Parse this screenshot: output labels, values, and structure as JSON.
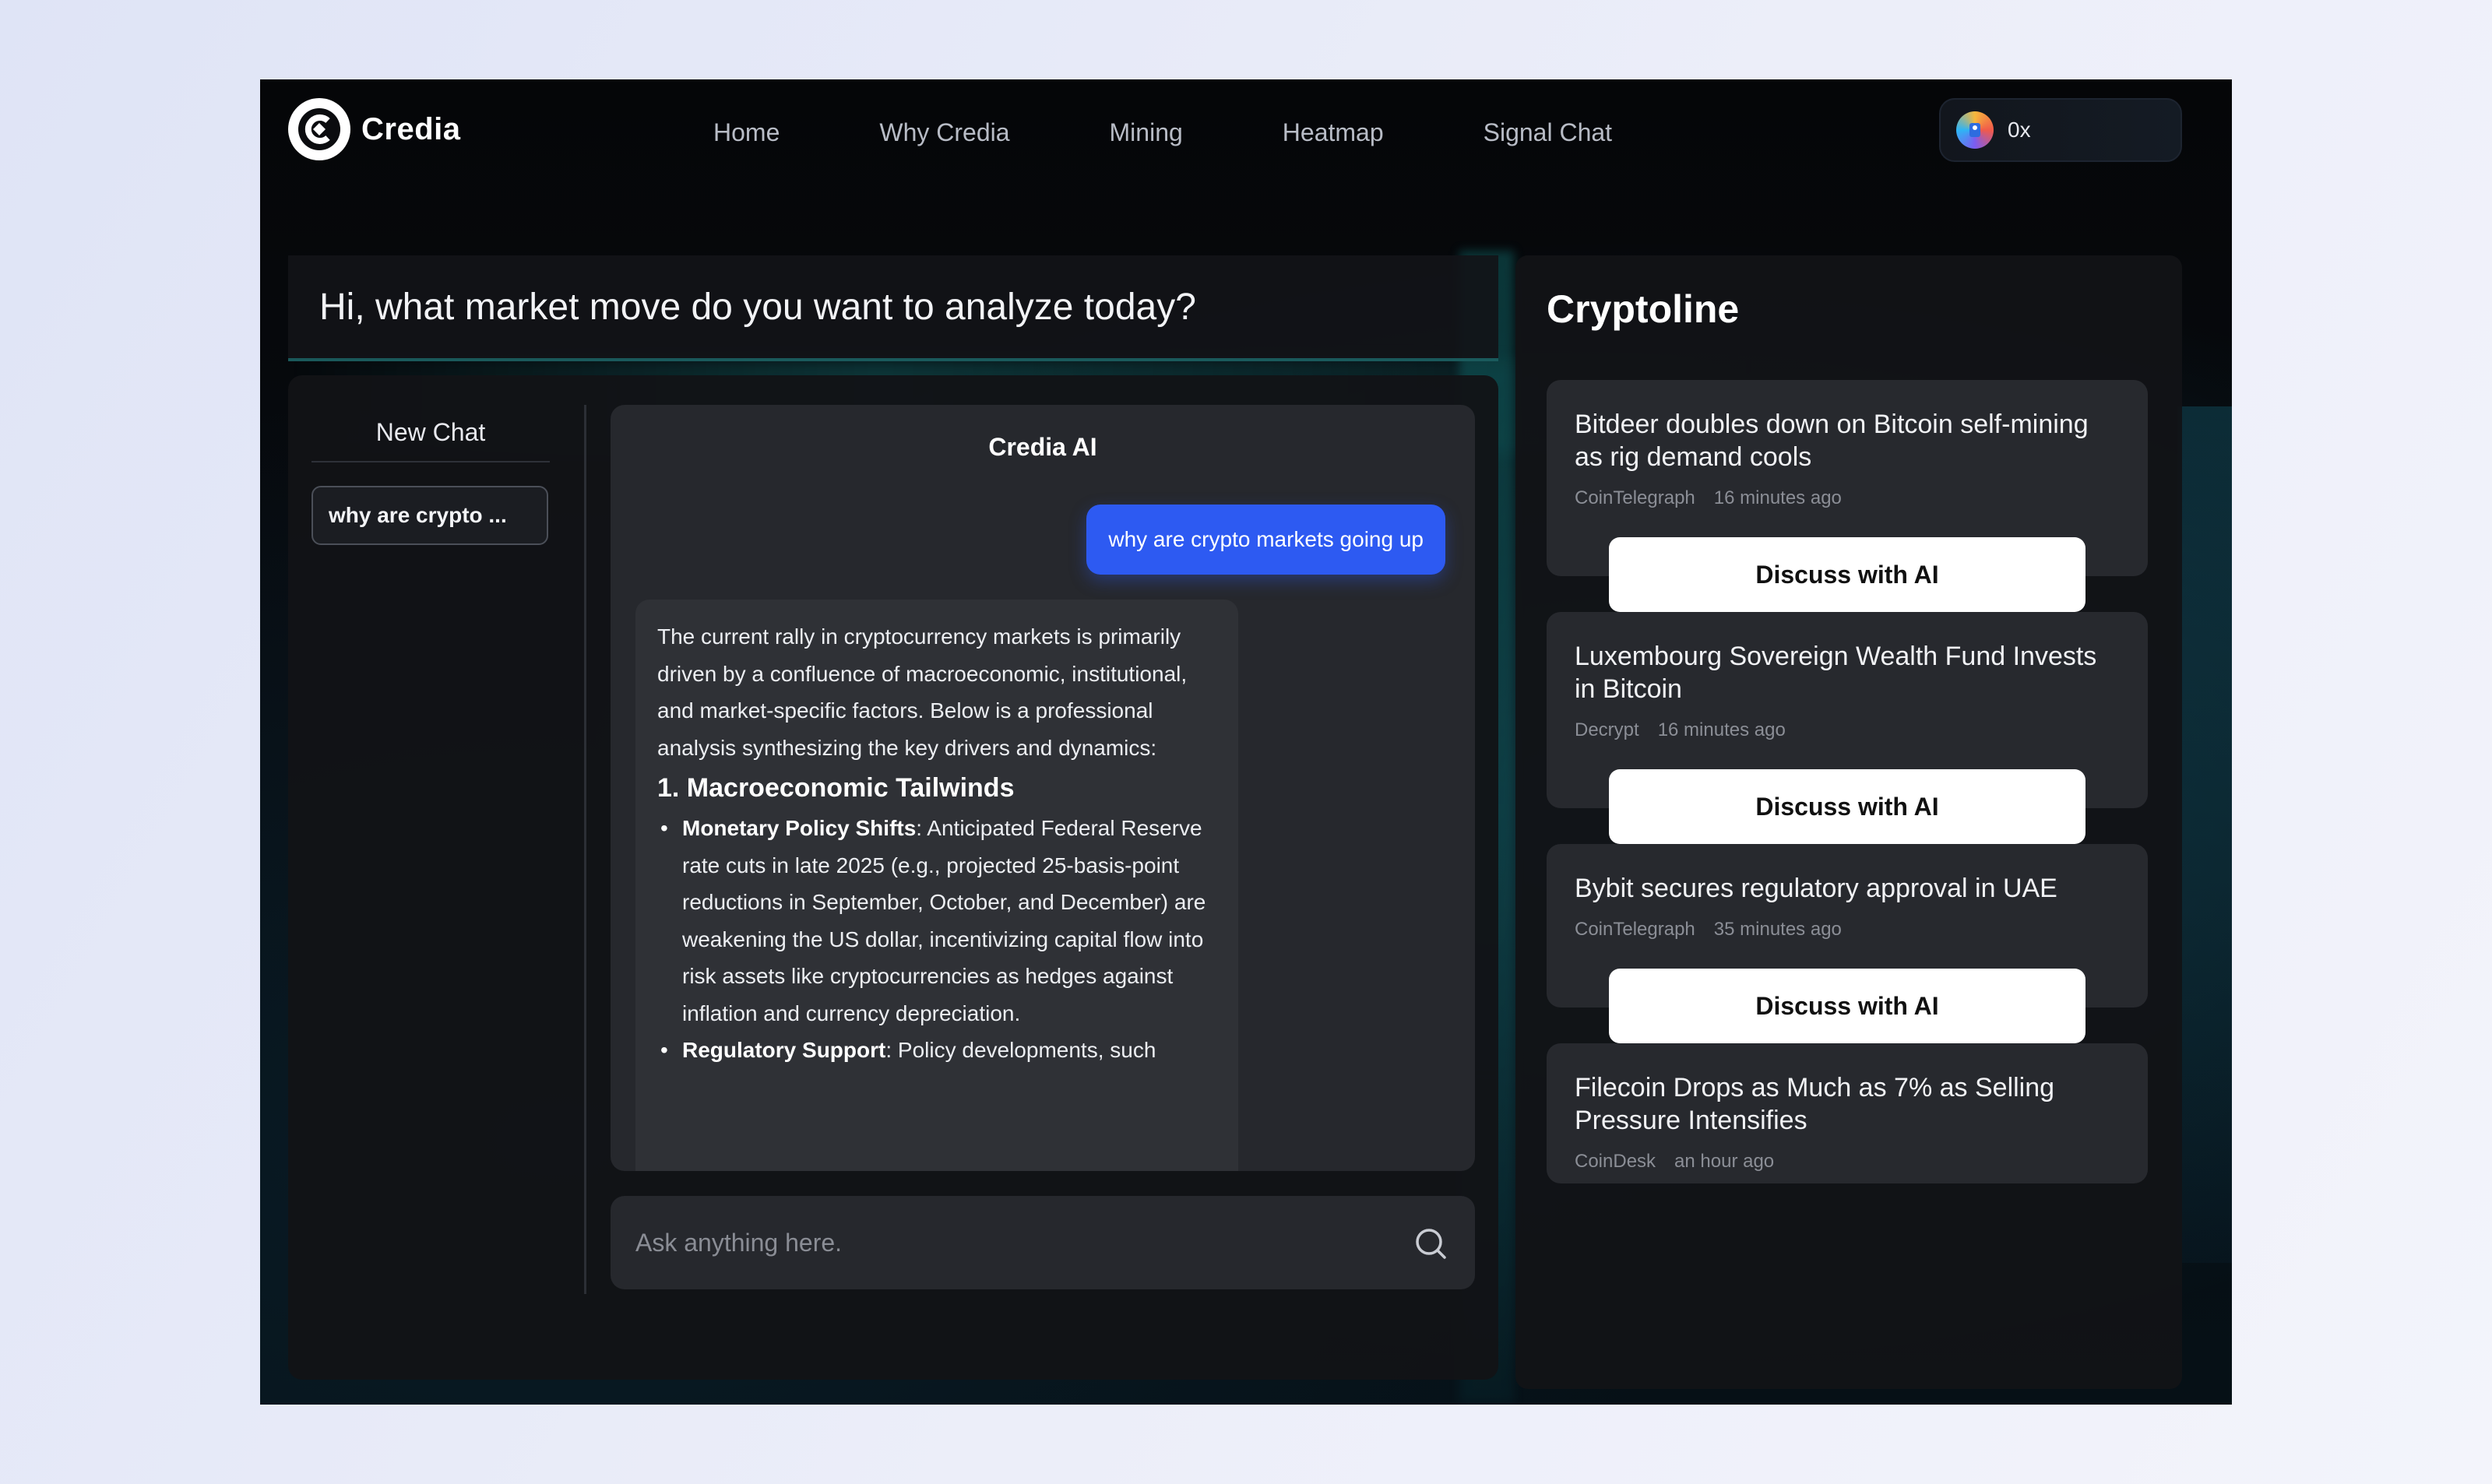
{
  "brand": {
    "name": "Credia"
  },
  "nav": {
    "items": [
      "Home",
      "Why Credia",
      "Mining",
      "Heatmap",
      "Signal Chat"
    ]
  },
  "wallet": {
    "label": "0x"
  },
  "greeting": "Hi, what market move do you want to analyze today?",
  "chat": {
    "new_chat_label": "New Chat",
    "history": [
      "why are crypto ..."
    ],
    "title": "Credia AI",
    "user_message": "why are crypto markets going up",
    "ai_intro": "The current rally in cryptocurrency markets is primarily driven by a confluence of macroeconomic, institutional, and market-specific factors. Below is a professional analysis synthesizing the key drivers and dynamics:",
    "ai_heading": "1. Macroeconomic Tailwinds",
    "ai_points": [
      {
        "bold": "Monetary Policy Shifts",
        "text": ": Anticipated Federal Reserve rate cuts in late 2025 (e.g., projected 25-basis-point reductions in September, October, and December) are weakening the US dollar, incentivizing capital flow into risk assets like cryptocurrencies as hedges against inflation and currency depreciation."
      },
      {
        "bold": "Regulatory Support",
        "text": ": Policy developments, such"
      }
    ],
    "input_placeholder": "Ask anything here."
  },
  "cryptoline": {
    "title": "Cryptoline",
    "discuss_label": "Discuss with AI",
    "news": [
      {
        "headline": "Bitdeer doubles down on Bitcoin self-mining as rig demand cools",
        "source": "CoinTelegraph",
        "time": "16 minutes ago"
      },
      {
        "headline": "Luxembourg Sovereign Wealth Fund Invests in Bitcoin",
        "source": "Decrypt",
        "time": "16 minutes ago"
      },
      {
        "headline": "Bybit secures regulatory approval in UAE",
        "source": "CoinTelegraph",
        "time": "35 minutes ago"
      },
      {
        "headline": "Filecoin Drops as Much as 7% as Selling Pressure Intensifies",
        "source": "CoinDesk",
        "time": "an hour ago"
      }
    ]
  }
}
